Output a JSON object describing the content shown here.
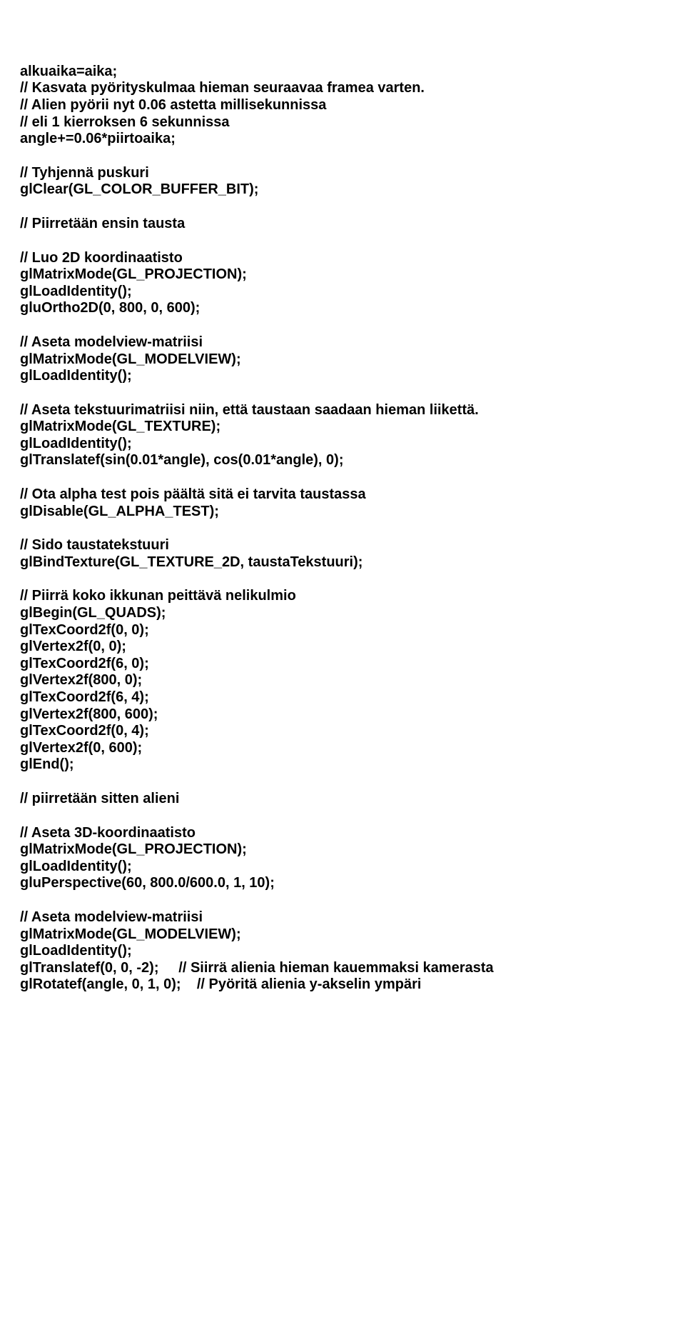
{
  "blocks": [
    "alkuaika=aika;\n// Kasvata pyörityskulmaa hieman seuraavaa framea varten.\n// Alien pyörii nyt 0.06 astetta millisekunnissa\n// eli 1 kierroksen 6 sekunnissa\nangle+=0.06*piirtoaika;",
    "// Tyhjennä puskuri\nglClear(GL_COLOR_BUFFER_BIT);",
    "// Piirretään ensin tausta",
    "// Luo 2D koordinaatisto\nglMatrixMode(GL_PROJECTION);\nglLoadIdentity();\ngluOrtho2D(0, 800, 0, 600);",
    "// Aseta modelview-matriisi\nglMatrixMode(GL_MODELVIEW);\nglLoadIdentity();",
    "// Aseta tekstuurimatriisi niin, että taustaan saadaan hieman liikettä.\nglMatrixMode(GL_TEXTURE);\nglLoadIdentity();\nglTranslatef(sin(0.01*angle), cos(0.01*angle), 0);",
    "// Ota alpha test pois päältä sitä ei tarvita taustassa\nglDisable(GL_ALPHA_TEST);",
    "// Sido taustatekstuuri\nglBindTexture(GL_TEXTURE_2D, taustaTekstuuri);",
    "// Piirrä koko ikkunan peittävä nelikulmio\nglBegin(GL_QUADS);\nglTexCoord2f(0, 0);\nglVertex2f(0, 0);\nglTexCoord2f(6, 0);\nglVertex2f(800, 0);\nglTexCoord2f(6, 4);\nglVertex2f(800, 600);\nglTexCoord2f(0, 4);\nglVertex2f(0, 600);\nglEnd();",
    "// piirretään sitten alieni",
    "// Aseta 3D-koordinaatisto\nglMatrixMode(GL_PROJECTION);\nglLoadIdentity();\ngluPerspective(60, 800.0/600.0, 1, 10);",
    "// Aseta modelview-matriisi\nglMatrixMode(GL_MODELVIEW);\nglLoadIdentity();\nglTranslatef(0, 0, -2);     // Siirrä alienia hieman kauemmaksi kamerasta\nglRotatef(angle, 0, 1, 0);    // Pyöritä alienia y-akselin ympäri"
  ]
}
